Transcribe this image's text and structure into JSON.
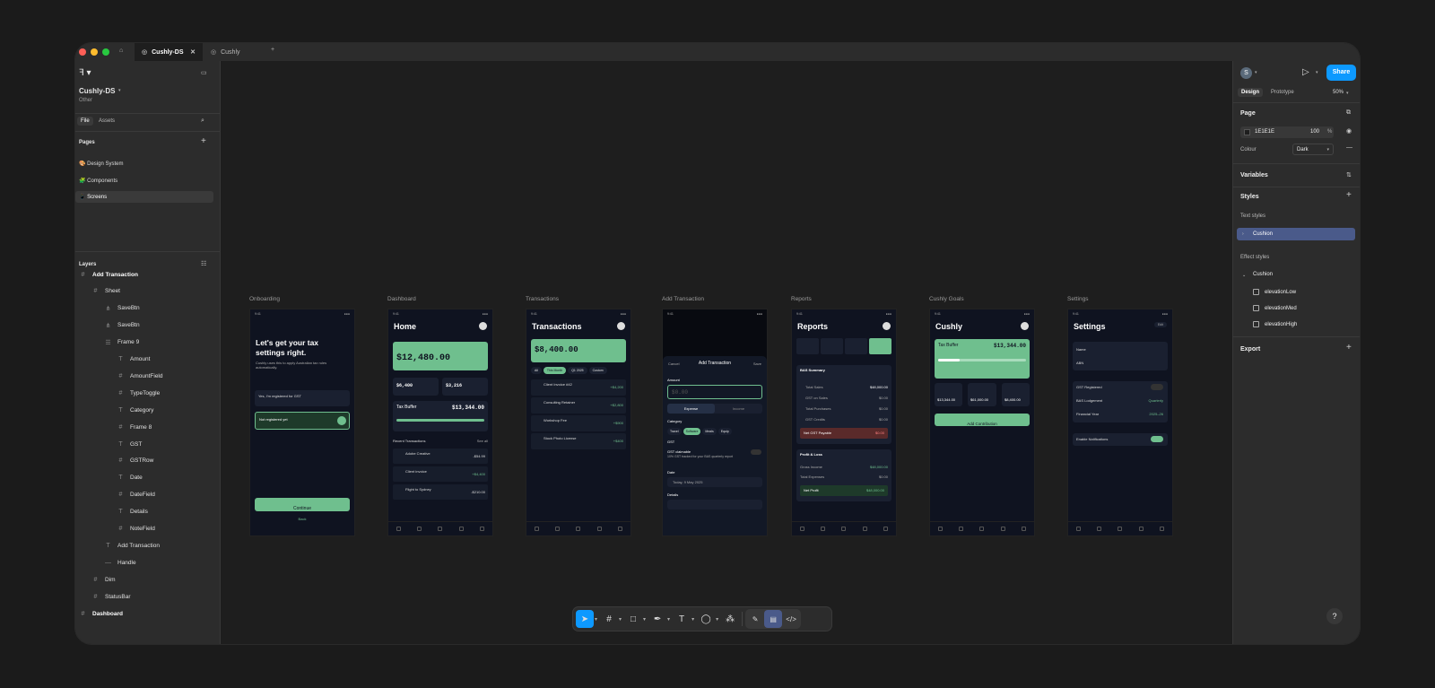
{
  "app": {
    "tabs": [
      {
        "label": "Cushly-DS"
      },
      {
        "label": "Cushly"
      }
    ],
    "new_tab": "+"
  },
  "left": {
    "file_name": "Cushly-DS",
    "file_sub": "Other",
    "tab_file": "File",
    "tab_assets": "Assets",
    "pages_title": "Pages",
    "pages": [
      {
        "label": "🎨 Design System"
      },
      {
        "label": "🧩 Components"
      },
      {
        "label": "📱 Screens"
      }
    ],
    "layers_title": "Layers",
    "layers": [
      {
        "label": "Add Transaction",
        "icon": "#",
        "indent": 0,
        "bold": true
      },
      {
        "label": "Sheet",
        "icon": "#",
        "indent": 1
      },
      {
        "label": "SaveBtn",
        "icon": "⋔",
        "indent": 2
      },
      {
        "label": "SaveBtn",
        "icon": "⋔",
        "indent": 2
      },
      {
        "label": "Frame 9",
        "icon": "☰",
        "indent": 2
      },
      {
        "label": "Amount",
        "icon": "T",
        "indent": 3
      },
      {
        "label": "AmountField",
        "icon": "#",
        "indent": 3
      },
      {
        "label": "TypeToggle",
        "icon": "#",
        "indent": 3
      },
      {
        "label": "Category",
        "icon": "T",
        "indent": 3
      },
      {
        "label": "Frame 8",
        "icon": "#",
        "indent": 3
      },
      {
        "label": "GST",
        "icon": "T",
        "indent": 3
      },
      {
        "label": "GSTRow",
        "icon": "#",
        "indent": 3
      },
      {
        "label": "Date",
        "icon": "T",
        "indent": 3
      },
      {
        "label": "DateField",
        "icon": "#",
        "indent": 3
      },
      {
        "label": "Details",
        "icon": "T",
        "indent": 3
      },
      {
        "label": "NoteField",
        "icon": "#",
        "indent": 3
      },
      {
        "label": "Add Transaction",
        "icon": "T",
        "indent": 2
      },
      {
        "label": "Handle",
        "icon": "—",
        "indent": 2
      },
      {
        "label": "Dim",
        "icon": "#",
        "indent": 1
      },
      {
        "label": "StatusBar",
        "icon": "#",
        "indent": 1
      },
      {
        "label": "Dashboard",
        "icon": "#",
        "indent": 0,
        "bold": true
      }
    ]
  },
  "right": {
    "avatar": "S",
    "share": "Share",
    "tab_design": "Design",
    "tab_prototype": "Prototype",
    "zoom": "50%",
    "page_title": "Page",
    "page_color": "1E1E1E",
    "page_opacity": "100",
    "percent": "%",
    "colour_label": "Colour",
    "colour_value": "Dark",
    "variables": "Variables",
    "styles": "Styles",
    "text_styles": "Text styles",
    "text_style_item": "Cushion",
    "effect_styles": "Effect styles",
    "effect_group": "Cushion",
    "effects": [
      {
        "label": "elevationLow"
      },
      {
        "label": "elevationMed"
      },
      {
        "label": "elevationHigh"
      }
    ],
    "export": "Export",
    "help": "?"
  },
  "frames": [
    {
      "label": "Onboarding"
    },
    {
      "label": "Dashboard"
    },
    {
      "label": "Transactions"
    },
    {
      "label": "Add Transaction"
    },
    {
      "label": "Reports"
    },
    {
      "label": "Cushly Goals"
    },
    {
      "label": "Settings"
    }
  ],
  "screens": {
    "status_time": "9:41",
    "onboarding": {
      "title": "Let's get your tax settings right.",
      "body": "Cushly uses this to apply Australian tax rules automatically.",
      "opt1": "Yes, I'm registered for GST",
      "opt2": "Not registered yet",
      "cta": "Continue",
      "back": "Back"
    },
    "dashboard": {
      "title": "Home",
      "balance": "$12,480.00",
      "a": "$6,400",
      "b": "$3,216",
      "buffer_title": "Tax Buffer",
      "buffer_amt": "$13,344.00",
      "recent": "Recent Transactions",
      "see_all": "See all",
      "tx": [
        {
          "name": "Adobe Creative",
          "amt": "-$54.99"
        },
        {
          "name": "Client invoice",
          "amt": "+$4,400"
        },
        {
          "name": "Flight to Sydney",
          "amt": "-$210.00"
        }
      ]
    },
    "transactions": {
      "title": "Transactions",
      "total": "$8,400.00",
      "chips": [
        "All",
        "This Month",
        "Q1 2025",
        "Custom"
      ],
      "tx": [
        {
          "name": "Client Invoice #42",
          "amt": "+$4,200"
        },
        {
          "name": "Consulting Retainer",
          "amt": "+$2,800"
        },
        {
          "name": "Workshop Fee",
          "amt": "+$900"
        },
        {
          "name": "Stock Photo License",
          "amt": "+$400"
        }
      ]
    },
    "add": {
      "cancel": "Cancel",
      "title": "Add Transaction",
      "save": "Save",
      "amount": "Amount",
      "placeholder": "$0.00",
      "expense": "Expense",
      "income": "Income",
      "category": "Category",
      "cats": [
        "Travel",
        "Software",
        "Meals",
        "Equip"
      ],
      "gst": "GST",
      "gst_claim": "GST claimable",
      "gst_note": "10% GST tracked for your BAS quarterly report",
      "date": "Date",
      "date_val": "Today, 9 May 2025",
      "details": "Details"
    },
    "reports": {
      "title": "Reports",
      "bas": "BAS Summary",
      "rows": [
        {
          "k": "Total Sales",
          "v": "$48,000.00"
        },
        {
          "k": "GST on Sales",
          "v": "$0.00"
        },
        {
          "k": "Total Purchases",
          "v": "$0.00"
        },
        {
          "k": "GST Credits",
          "v": "$0.00"
        }
      ],
      "net_gst": "Net GST Payable",
      "net_gst_v": "$0.00",
      "pl": "Profit & Loss",
      "pl_rows": [
        {
          "k": "Gross Income",
          "v": "$48,000.00"
        },
        {
          "k": "Total Expenses",
          "v": "$0.00"
        }
      ],
      "net_profit": "Net Profit",
      "net_profit_v": "$48,000.00"
    },
    "goals": {
      "title": "Cushly",
      "buffer_title": "Tax Buffer",
      "buffer_amt": "$13,344.00",
      "s1": "$13,344.00",
      "s2": "$61,000.00",
      "s3": "$8,400.00",
      "cta": "Add Contribution"
    },
    "settings": {
      "title": "Settings",
      "edit": "Edit",
      "name": "Name",
      "abn": "ABN",
      "gst_reg": "GST Registered",
      "bas": "BAS Lodgement",
      "bas_v": "Quarterly",
      "fy": "Financial Year",
      "fy_v": "2025–26",
      "notif": "Enable Notifications"
    }
  },
  "colors": {
    "accent": "#0d99ff",
    "green": "#6fbf8e",
    "canvas": "#1e1e1e",
    "panel": "#2c2c2c",
    "selected": "#4a5a8a"
  }
}
